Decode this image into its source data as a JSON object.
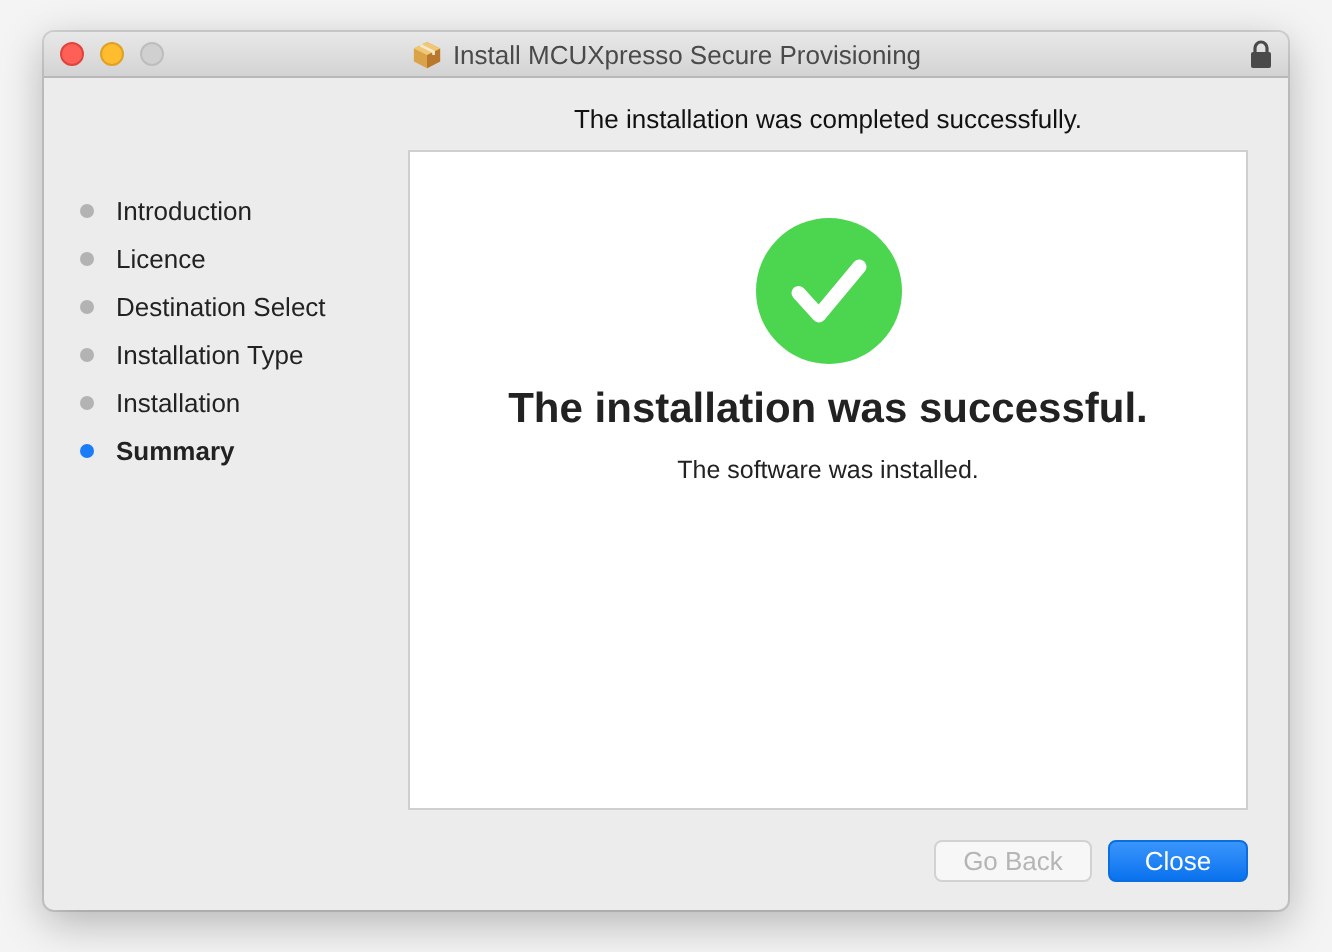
{
  "window": {
    "title": "Install MCUXpresso Secure Provisioning"
  },
  "heading": "The installation was completed successfully.",
  "steps": [
    {
      "label": "Introduction",
      "selected": false
    },
    {
      "label": "Licence",
      "selected": false
    },
    {
      "label": "Destination Select",
      "selected": false
    },
    {
      "label": "Installation Type",
      "selected": false
    },
    {
      "label": "Installation",
      "selected": false
    },
    {
      "label": "Summary",
      "selected": true
    }
  ],
  "panel": {
    "title": "The installation was successful.",
    "message": "The software was installed."
  },
  "buttons": [
    {
      "label": "Go Back",
      "disabled": true,
      "kind": "secondary"
    },
    {
      "label": "Close",
      "disabled": false,
      "kind": "primary"
    }
  ]
}
